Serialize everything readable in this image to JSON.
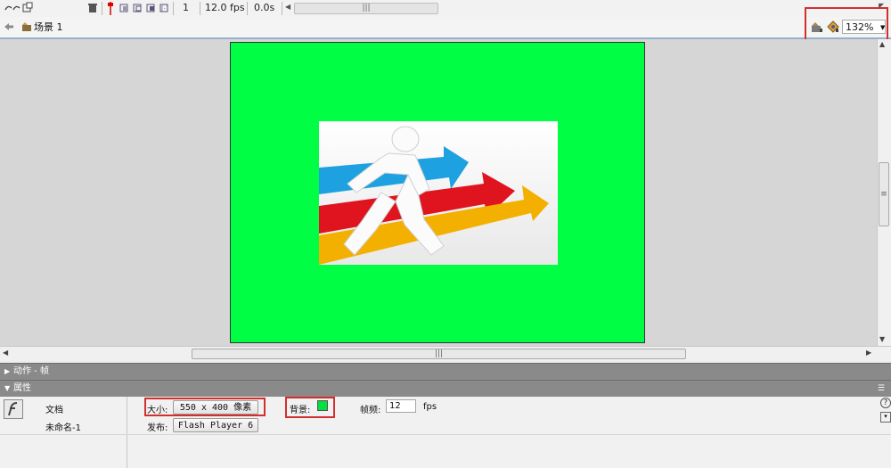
{
  "timeline": {
    "frame": "1",
    "fps": "12.0 fps",
    "time": "0.0s"
  },
  "scene": {
    "name": "场景 1",
    "zoom": "132%"
  },
  "panels": {
    "actions_title": "动作 - 帧",
    "properties_title": "属性"
  },
  "properties": {
    "doc_type": "文档",
    "doc_name": "未命名-1",
    "size_label": "大小:",
    "size_value": "550 x 400 像素",
    "publish_label": "发布:",
    "publish_value": "Flash Player 6",
    "background_label": "背景:",
    "background_color": "#00e040",
    "fps_label": "帧频:",
    "fps_value": "12",
    "fps_unit": "fps"
  },
  "stage": {
    "background_color": "#00ff44"
  },
  "icons": [
    "onion-skin-icons",
    "delete-layer-icon",
    "playhead-icon",
    "edit-scene-icon",
    "edit-symbol-icon",
    "flash-logo-icon",
    "help-icon",
    "panel-options-icon"
  ]
}
